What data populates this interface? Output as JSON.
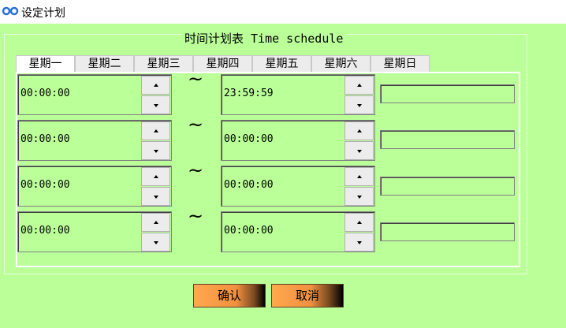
{
  "window": {
    "title": "设定计划"
  },
  "group": {
    "title": "时间计划表 Time schedule"
  },
  "tabs": [
    "星期一",
    "星期二",
    "星期三",
    "星期四",
    "星期五",
    "星期六",
    "星期日"
  ],
  "active_tab": "星期一",
  "rows": [
    {
      "start": "00:00:00",
      "end": "23:59:59",
      "separator": "~",
      "note": ""
    },
    {
      "start": "00:00:00",
      "end": "00:00:00",
      "separator": "~",
      "note": ""
    },
    {
      "start": "00:00:00",
      "end": "00:00:00",
      "separator": "~",
      "note": ""
    },
    {
      "start": "00:00:00",
      "end": "00:00:00",
      "separator": "~",
      "note": ""
    }
  ],
  "buttons": {
    "ok": "确认",
    "cancel": "取消"
  },
  "colors": {
    "panel_bg": "#bbff99",
    "button_orange": "#ffa94d"
  },
  "icons": {
    "app": "infinity-link-icon"
  }
}
